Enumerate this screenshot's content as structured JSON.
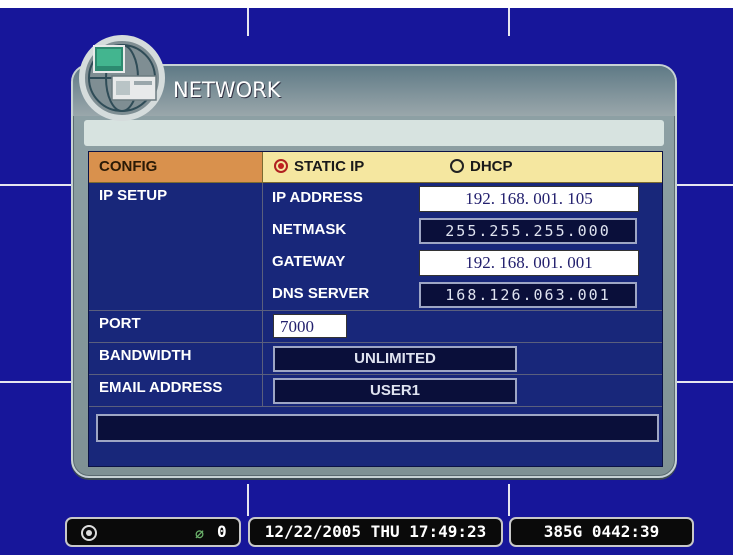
{
  "window": {
    "title": "NETWORK"
  },
  "config": {
    "label": "CONFIG",
    "options": [
      {
        "label": "STATIC IP",
        "selected": true
      },
      {
        "label": "DHCP",
        "selected": false
      }
    ]
  },
  "ip_setup": {
    "label": "IP SETUP",
    "fields": [
      {
        "label": "IP ADDRESS",
        "value": "192. 168. 001. 105",
        "style": "editing"
      },
      {
        "label": "NETMASK",
        "value": "255.255.255.000",
        "style": "readonly"
      },
      {
        "label": "GATEWAY",
        "value": "192. 168. 001. 001",
        "style": "editing"
      },
      {
        "label": "DNS SERVER",
        "value": "168.126.063.001",
        "style": "readonly"
      }
    ]
  },
  "port": {
    "label": "PORT",
    "value": "7000"
  },
  "bandwidth": {
    "label": "BANDWIDTH",
    "value": "UNLIMITED"
  },
  "email": {
    "label": "EMAIL ADDRESS",
    "value": "USER1"
  },
  "status_bar": {
    "record_icon": "record-icon",
    "network_icon": "network-icon",
    "network_count": "0",
    "datetime": "12/22/2005 THU 17:49:23",
    "storage": "385G  0442:39"
  },
  "colors": {
    "background": "#17169a",
    "config_row": "#f5e7a0",
    "config_label": "#d9914d",
    "form": "#18277a"
  }
}
